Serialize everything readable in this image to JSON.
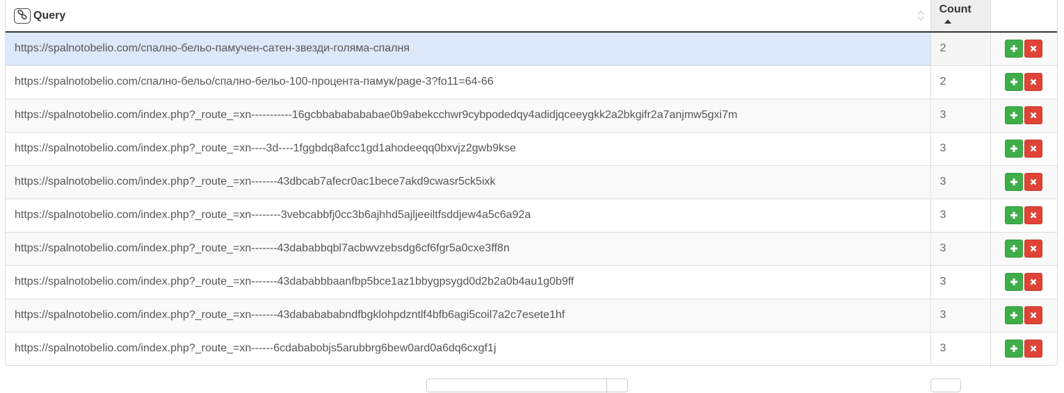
{
  "table": {
    "headers": {
      "query": "Query",
      "count": "Count"
    },
    "rows": [
      {
        "query": "https://spalnotobelio.com/спално-бельо-памучен-сатен-звезди-голяма-спалня",
        "count": "2"
      },
      {
        "query": "https://spalnotobelio.com/спално-бельо/спално-бельо-100-процента-памук/page-3?fo11=64-66",
        "count": "2"
      },
      {
        "query": "https://spalnotobelio.com/index.php?_route_=xn-----------16gcbbababababae0b9abekcchwr9cybpodedqy4adidjqceeygkk2a2bkgifr2a7anjmw5gxi7m",
        "count": "3"
      },
      {
        "query": "https://spalnotobelio.com/index.php?_route_=xn----3d----1fggbdq8afcc1gd1ahodeeqq0bxvjz2gwb9kse",
        "count": "3"
      },
      {
        "query": "https://spalnotobelio.com/index.php?_route_=xn-------43dbcab7afecr0ac1bece7akd9cwasr5ck5ixk",
        "count": "3"
      },
      {
        "query": "https://spalnotobelio.com/index.php?_route_=xn--------3vebcabbfj0cc3b6ajhhd5ajljeeiltfsddjew4a5c6a92a",
        "count": "3"
      },
      {
        "query": "https://spalnotobelio.com/index.php?_route_=xn-------43dababbqbl7acbwvzebsdg6cf6fgr5a0cxe3ff8n",
        "count": "3"
      },
      {
        "query": "https://spalnotobelio.com/index.php?_route_=xn-------43dababbbaanfbp5bce1az1bbygpsygd0d2b2a0b4au1g0b9ff",
        "count": "3"
      },
      {
        "query": "https://spalnotobelio.com/index.php?_route_=xn-------43dababababndfbgklohpdzntlf4bfb6agi5coil7a2c7esete1hf",
        "count": "3"
      },
      {
        "query": "https://spalnotobelio.com/index.php?_route_=xn------6cdababobjs5arubbrg6bew0ard0a6dq6cxgf1j",
        "count": "3"
      }
    ],
    "selected_row": 0,
    "sort": {
      "column": "count",
      "direction": "ascending"
    }
  },
  "icons": {
    "header_query": "link-icon",
    "add": "plus-icon",
    "remove": "close-icon"
  },
  "colors": {
    "add_button": "#3fae49",
    "remove_button": "#e04436",
    "selected_row": "#dde8fb"
  }
}
